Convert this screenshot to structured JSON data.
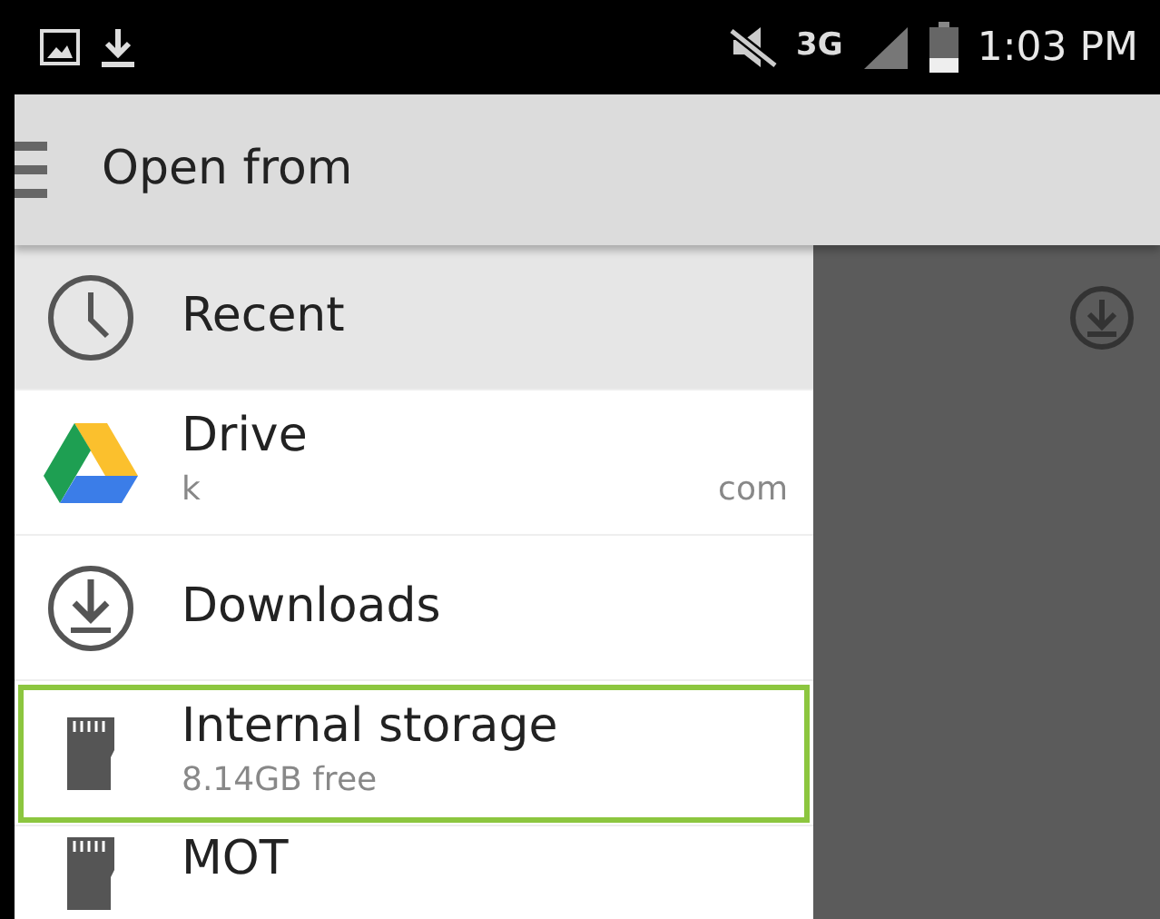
{
  "status_bar": {
    "time": "1:03 PM",
    "network": "3G"
  },
  "app_bar": {
    "title": "Open from"
  },
  "drawer": {
    "items": [
      {
        "kind": "recent",
        "label": "Recent",
        "selected": true,
        "highlighted": false
      },
      {
        "kind": "drive",
        "label": "Drive",
        "account_start": "k",
        "account_end": "com",
        "selected": false,
        "highlighted": false
      },
      {
        "kind": "downloads",
        "label": "Downloads",
        "selected": false,
        "highlighted": false
      },
      {
        "kind": "storage",
        "label": "Internal storage",
        "subtitle": "8.14GB free",
        "selected": false,
        "highlighted": true
      },
      {
        "kind": "storage",
        "label": "MOT",
        "selected": false,
        "highlighted": false
      }
    ]
  }
}
